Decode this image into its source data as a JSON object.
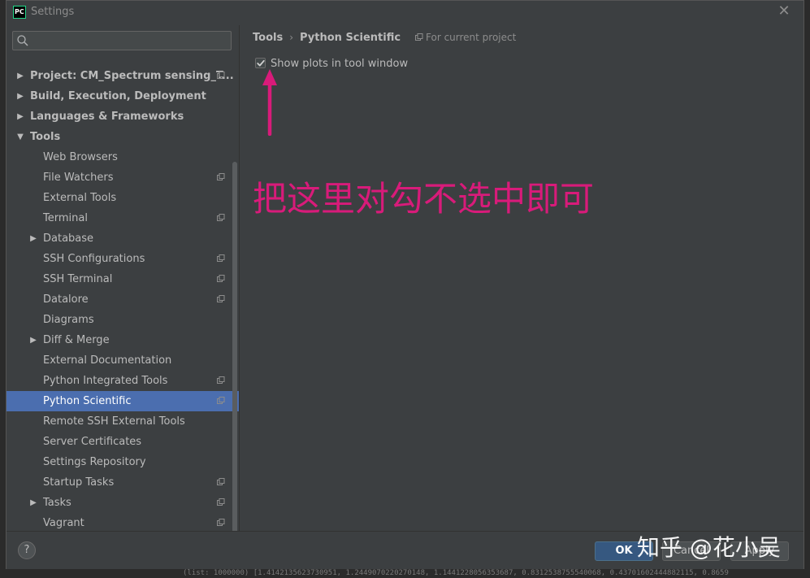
{
  "window": {
    "title": "Settings",
    "app_icon_text": "PC",
    "close_glyph": "✕"
  },
  "search": {
    "placeholder": "",
    "value": ""
  },
  "tree": {
    "items": [
      {
        "label": "Project: CM_Spectrum sensing_T...",
        "level": 0,
        "arrow": "▶",
        "copy": true,
        "bold": true
      },
      {
        "label": "Build, Execution, Deployment",
        "level": 0,
        "arrow": "▶",
        "copy": false,
        "bold": true
      },
      {
        "label": "Languages & Frameworks",
        "level": 0,
        "arrow": "▶",
        "copy": false,
        "bold": true
      },
      {
        "label": "Tools",
        "level": 0,
        "arrow": "▼",
        "copy": false,
        "bold": true
      },
      {
        "label": "Web Browsers",
        "level": 1,
        "arrow": "",
        "copy": false,
        "bold": false
      },
      {
        "label": "File Watchers",
        "level": 1,
        "arrow": "",
        "copy": true,
        "bold": false
      },
      {
        "label": "External Tools",
        "level": 1,
        "arrow": "",
        "copy": false,
        "bold": false
      },
      {
        "label": "Terminal",
        "level": 1,
        "arrow": "",
        "copy": true,
        "bold": false
      },
      {
        "label": "Database",
        "level": 1,
        "arrow": "▶",
        "copy": false,
        "bold": false
      },
      {
        "label": "SSH Configurations",
        "level": 1,
        "arrow": "",
        "copy": true,
        "bold": false
      },
      {
        "label": "SSH Terminal",
        "level": 1,
        "arrow": "",
        "copy": true,
        "bold": false
      },
      {
        "label": "Datalore",
        "level": 1,
        "arrow": "",
        "copy": true,
        "bold": false
      },
      {
        "label": "Diagrams",
        "level": 1,
        "arrow": "",
        "copy": false,
        "bold": false
      },
      {
        "label": "Diff & Merge",
        "level": 1,
        "arrow": "▶",
        "copy": false,
        "bold": false
      },
      {
        "label": "External Documentation",
        "level": 1,
        "arrow": "",
        "copy": false,
        "bold": false
      },
      {
        "label": "Python Integrated Tools",
        "level": 1,
        "arrow": "",
        "copy": true,
        "bold": false
      },
      {
        "label": "Python Scientific",
        "level": 1,
        "arrow": "",
        "copy": true,
        "bold": false,
        "selected": true
      },
      {
        "label": "Remote SSH External Tools",
        "level": 1,
        "arrow": "",
        "copy": false,
        "bold": false
      },
      {
        "label": "Server Certificates",
        "level": 1,
        "arrow": "",
        "copy": false,
        "bold": false
      },
      {
        "label": "Settings Repository",
        "level": 1,
        "arrow": "",
        "copy": false,
        "bold": false
      },
      {
        "label": "Startup Tasks",
        "level": 1,
        "arrow": "",
        "copy": true,
        "bold": false
      },
      {
        "label": "Tasks",
        "level": 1,
        "arrow": "▶",
        "copy": true,
        "bold": false
      },
      {
        "label": "Vagrant",
        "level": 1,
        "arrow": "",
        "copy": true,
        "bold": false
      }
    ]
  },
  "breadcrumb": {
    "parent": "Tools",
    "separator": "›",
    "current": "Python Scientific",
    "scope_hint": "For current project"
  },
  "content": {
    "show_plots_label": "Show plots in tool window",
    "show_plots_checked": true,
    "annotation_text": "把这里对勾不选中即可"
  },
  "footer": {
    "help_label": "?",
    "ok_label": "OK",
    "cancel_label": "Cancel",
    "apply_label": "Apply"
  },
  "watermark": "知乎 @花小吴",
  "bottom_strip_text": "(list: 1000000) [1.4142135623730951, 1.2449070220270148, 1.1441228056353687, 0.8312538755540068, 0.43701602444882115, 0.8659"
}
